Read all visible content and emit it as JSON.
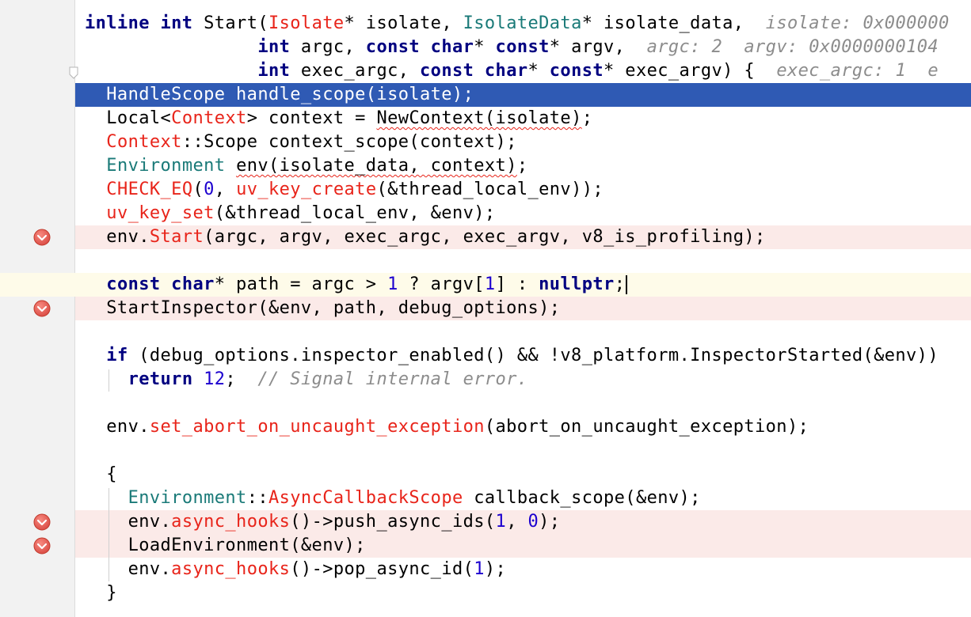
{
  "editor": {
    "lines": [
      {
        "segments": [
          {
            "text": "inline int ",
            "cls": "k"
          },
          {
            "text": "Start(",
            "cls": ""
          },
          {
            "text": "Isolate",
            "cls": "t"
          },
          {
            "text": "* isolate, ",
            "cls": ""
          },
          {
            "text": "IsolateData",
            "cls": "g"
          },
          {
            "text": "* isolate_data,  ",
            "cls": ""
          },
          {
            "text": "isolate: 0x000000",
            "cls": "h"
          }
        ]
      },
      {
        "segments": [
          {
            "text": "                ",
            "cls": ""
          },
          {
            "text": "int ",
            "cls": "k"
          },
          {
            "text": "argc, ",
            "cls": ""
          },
          {
            "text": "const char",
            "cls": "k"
          },
          {
            "text": "* ",
            "cls": ""
          },
          {
            "text": "const",
            "cls": "k"
          },
          {
            "text": "* argv,  ",
            "cls": ""
          },
          {
            "text": "argc: 2  argv: 0x0000000104",
            "cls": "h"
          }
        ]
      },
      {
        "segments": [
          {
            "text": "                ",
            "cls": ""
          },
          {
            "text": "int ",
            "cls": "k"
          },
          {
            "text": "exec_argc, ",
            "cls": ""
          },
          {
            "text": "const char",
            "cls": "k"
          },
          {
            "text": "* ",
            "cls": ""
          },
          {
            "text": "const",
            "cls": "k"
          },
          {
            "text": "* exec_argv) {  ",
            "cls": ""
          },
          {
            "text": "exec_argc: 1  e",
            "cls": "h"
          }
        ]
      },
      {
        "selected": true,
        "segments": [
          {
            "text": "  HandleScope handle_scope(isolate);",
            "cls": ""
          }
        ]
      },
      {
        "segments": [
          {
            "text": "  Local<",
            "cls": ""
          },
          {
            "text": "Context",
            "cls": "t"
          },
          {
            "text": "> context = ",
            "cls": ""
          },
          {
            "text": "NewContext(isolate)",
            "cls": "sq"
          },
          {
            "text": ";",
            "cls": ""
          }
        ]
      },
      {
        "segments": [
          {
            "text": "  ",
            "cls": ""
          },
          {
            "text": "Context",
            "cls": "t"
          },
          {
            "text": "::Scope context_scope(context);",
            "cls": ""
          }
        ]
      },
      {
        "segments": [
          {
            "text": "  ",
            "cls": ""
          },
          {
            "text": "Environment",
            "cls": "g"
          },
          {
            "text": " ",
            "cls": ""
          },
          {
            "text": "env(isolate_data, context)",
            "cls": "sq"
          },
          {
            "text": ";",
            "cls": ""
          }
        ]
      },
      {
        "segments": [
          {
            "text": "  ",
            "cls": ""
          },
          {
            "text": "CHECK_EQ",
            "cls": "t"
          },
          {
            "text": "(",
            "cls": ""
          },
          {
            "text": "0",
            "cls": "n"
          },
          {
            "text": ", ",
            "cls": ""
          },
          {
            "text": "uv_key_create",
            "cls": "t"
          },
          {
            "text": "(&thread_local_env));",
            "cls": ""
          }
        ]
      },
      {
        "segments": [
          {
            "text": "  ",
            "cls": ""
          },
          {
            "text": "uv_key_set",
            "cls": "t"
          },
          {
            "text": "(&thread_local_env, &env);",
            "cls": ""
          }
        ]
      },
      {
        "breakpoint": true,
        "segments": [
          {
            "text": "  env.",
            "cls": ""
          },
          {
            "text": "Start",
            "cls": "t"
          },
          {
            "text": "(argc, argv, exec_argc, exec_argv, v8_is_profiling);",
            "cls": ""
          }
        ]
      },
      {
        "segments": []
      },
      {
        "current": true,
        "caret": true,
        "segments": [
          {
            "text": "  ",
            "cls": ""
          },
          {
            "text": "const char",
            "cls": "k"
          },
          {
            "text": "* path = argc > ",
            "cls": ""
          },
          {
            "text": "1",
            "cls": "n"
          },
          {
            "text": " ? argv[",
            "cls": ""
          },
          {
            "text": "1",
            "cls": "n"
          },
          {
            "text": "] : ",
            "cls": ""
          },
          {
            "text": "nullptr",
            "cls": "k"
          },
          {
            "text": ";",
            "cls": ""
          }
        ]
      },
      {
        "breakpoint": true,
        "segments": [
          {
            "text": "  StartInspector(&env, path, debug_options);",
            "cls": ""
          }
        ]
      },
      {
        "segments": []
      },
      {
        "segments": [
          {
            "text": "  ",
            "cls": ""
          },
          {
            "text": "if",
            "cls": "k"
          },
          {
            "text": " (debug_options.inspector_enabled() && !v8_platform.InspectorStarted(&env))",
            "cls": ""
          }
        ]
      },
      {
        "segments": [
          {
            "text": "    ",
            "cls": ""
          },
          {
            "text": "return",
            "cls": "k"
          },
          {
            "text": " ",
            "cls": ""
          },
          {
            "text": "12",
            "cls": "n"
          },
          {
            "text": ";  ",
            "cls": ""
          },
          {
            "text": "// Signal internal error.",
            "cls": "c"
          }
        ]
      },
      {
        "segments": []
      },
      {
        "segments": [
          {
            "text": "  env.",
            "cls": ""
          },
          {
            "text": "set_abort_on_uncaught_exception",
            "cls": "t"
          },
          {
            "text": "(abort_on_uncaught_exception);",
            "cls": ""
          }
        ]
      },
      {
        "segments": []
      },
      {
        "segments": [
          {
            "text": "  {",
            "cls": ""
          }
        ]
      },
      {
        "segments": [
          {
            "text": "    ",
            "cls": ""
          },
          {
            "text": "Environment",
            "cls": "g"
          },
          {
            "text": "::",
            "cls": ""
          },
          {
            "text": "AsyncCallbackScope",
            "cls": "t"
          },
          {
            "text": " callback_scope(&env);",
            "cls": ""
          }
        ]
      },
      {
        "breakpoint": true,
        "segments": [
          {
            "text": "    env.",
            "cls": ""
          },
          {
            "text": "async_hooks",
            "cls": "t"
          },
          {
            "text": "()->push_async_ids(",
            "cls": ""
          },
          {
            "text": "1",
            "cls": "n"
          },
          {
            "text": ", ",
            "cls": ""
          },
          {
            "text": "0",
            "cls": "n"
          },
          {
            "text": ");",
            "cls": ""
          }
        ]
      },
      {
        "breakpoint": true,
        "segments": [
          {
            "text": "    LoadEnvironment(&env);",
            "cls": ""
          }
        ]
      },
      {
        "segments": [
          {
            "text": "    env.",
            "cls": ""
          },
          {
            "text": "async_hooks",
            "cls": "t"
          },
          {
            "text": "()->pop_async_id(",
            "cls": ""
          },
          {
            "text": "1",
            "cls": "n"
          },
          {
            "text": ");",
            "cls": ""
          }
        ]
      },
      {
        "segments": [
          {
            "text": "  }",
            "cls": ""
          }
        ]
      }
    ]
  },
  "icons": {
    "breakpoint": "breakpoint-icon",
    "fold": "fold-marker-icon"
  },
  "colors": {
    "keyword": "#000080",
    "type_or_call": "#e8241a",
    "class": "#1a7a78",
    "number": "#1c00cf",
    "comment": "#8c8c8c",
    "selection": "#2f5ab4",
    "breakpoint_line": "#fbeae8",
    "current_line": "#fefbe9",
    "breakpoint": "#e8504a"
  }
}
